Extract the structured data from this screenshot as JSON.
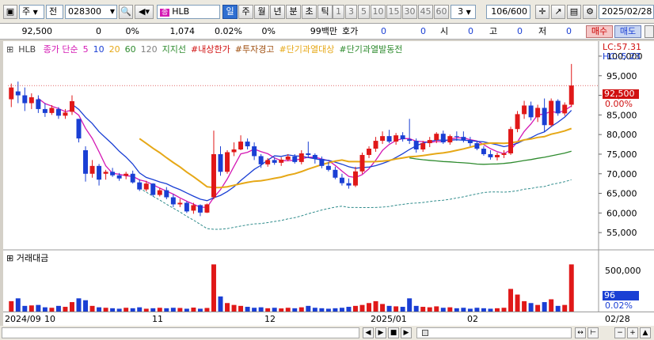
{
  "toolbar": {
    "period_select": "주",
    "scope_select": "전",
    "code": "028300",
    "name": "HLB",
    "period_tabs": [
      "일",
      "주",
      "월",
      "년",
      "분",
      "초",
      "틱"
    ],
    "active_period": "일",
    "intervals": [
      "1",
      "3",
      "5",
      "10",
      "15",
      "30",
      "45",
      "60"
    ],
    "interval_select": "3",
    "count": "106/600",
    "date": "2025/02/28"
  },
  "quote": {
    "price": "92,500",
    "change": "0",
    "rate": "0%",
    "volume": "1,074",
    "vol_rate": "0.02%",
    "vol_rate2": "0%",
    "amount": "99백만",
    "hoga_label": "호가",
    "hoga_val1": "0",
    "hoga_val2": "0",
    "open_label": "시",
    "open_val": "0",
    "high_label": "고",
    "high_val": "0",
    "low_label": "저",
    "low_val": "0",
    "buy_button": "매수",
    "sell_button": "매도"
  },
  "legend": {
    "name": "HLB",
    "ma_label": "종가 단순",
    "ma5": "5",
    "ma10": "10",
    "ma20": "20",
    "ma60": "60",
    "ma120": "120",
    "support": "지지선",
    "limit": "#내상한가",
    "warn": "#투자경고",
    "short1": "#단기과열대상",
    "short2": "#단기과열발동전",
    "colors": {
      "ma5": "#d418b4",
      "ma10": "#1a3fd4",
      "ma20": "#e6a817",
      "ma60": "#2e8b2e",
      "ma120": "#808080",
      "limit": "#d01010",
      "warn": "#a05010",
      "short1": "#e6a817",
      "short2": "#2e8b2e"
    }
  },
  "price_axis": {
    "ticks": [
      "100,000",
      "95,000",
      "90,000",
      "85,000",
      "80,000",
      "75,000",
      "70,000",
      "65,000",
      "60,000",
      "55,000"
    ],
    "lc": "LC:57.31",
    "hc": "HC:-5.23",
    "current": "92,500",
    "current_rate": "0.00%"
  },
  "volume_panel": {
    "title": "거래대금",
    "ticks": [
      "500,000"
    ],
    "current": "96",
    "current_rate": "0.02%"
  },
  "date_axis": {
    "labels": [
      "2024/09",
      "10",
      "11",
      "12",
      "2025/01",
      "02"
    ],
    "right_label": "02/28"
  },
  "chart_data": {
    "type": "candlestick",
    "y_range": [
      51000,
      101000
    ],
    "candles": [
      [
        89000,
        93000,
        87000,
        92000
      ],
      [
        91000,
        93500,
        88000,
        90000
      ],
      [
        90000,
        92000,
        86000,
        88000
      ],
      [
        88000,
        90500,
        86500,
        89500
      ],
      [
        89000,
        90000,
        85500,
        86500
      ],
      [
        86500,
        88000,
        84500,
        85500
      ],
      [
        85500,
        87500,
        85000,
        86800
      ],
      [
        86500,
        87000,
        84000,
        84800
      ],
      [
        84800,
        86500,
        84000,
        85600
      ],
      [
        85800,
        90000,
        85000,
        88500
      ],
      [
        84000,
        84000,
        78000,
        79000
      ],
      [
        76000,
        77000,
        68000,
        70000
      ],
      [
        70000,
        73500,
        69000,
        72000
      ],
      [
        72000,
        72500,
        67000,
        68500
      ],
      [
        70000,
        71000,
        68500,
        70500
      ],
      [
        70500,
        71500,
        69200,
        69600
      ],
      [
        69600,
        70200,
        68200,
        68800
      ],
      [
        69500,
        70500,
        68600,
        70000
      ],
      [
        70000,
        70800,
        67500,
        67800
      ],
      [
        67800,
        68600,
        65600,
        66000
      ],
      [
        66000,
        68200,
        65500,
        67500
      ],
      [
        67500,
        67600,
        64200,
        64600
      ],
      [
        64600,
        66400,
        64200,
        65800
      ],
      [
        65800,
        66600,
        63500,
        64000
      ],
      [
        64000,
        64800,
        61500,
        62200
      ],
      [
        62200,
        63600,
        61500,
        62600
      ],
      [
        62600,
        63000,
        60000,
        60400
      ],
      [
        60600,
        62600,
        59800,
        62000
      ],
      [
        62000,
        62200,
        59200,
        60100
      ],
      [
        60100,
        62400,
        60000,
        62200
      ],
      [
        64000,
        81000,
        63500,
        75000
      ],
      [
        75000,
        77000,
        69500,
        70500
      ],
      [
        70500,
        76000,
        70000,
        75500
      ],
      [
        75500,
        78000,
        74500,
        76200
      ],
      [
        76200,
        79800,
        76000,
        78200
      ],
      [
        78200,
        79000,
        76200,
        77000
      ],
      [
        77000,
        78000,
        73500,
        74500
      ],
      [
        74500,
        75000,
        71500,
        72400
      ],
      [
        72400,
        74000,
        71800,
        73500
      ],
      [
        73500,
        74200,
        72300,
        72800
      ],
      [
        72800,
        74200,
        72000,
        73600
      ],
      [
        73600,
        75000,
        73200,
        74400
      ],
      [
        74400,
        75000,
        72600,
        73000
      ],
      [
        73000,
        76000,
        72400,
        75200
      ],
      [
        75200,
        78200,
        74000,
        74800
      ],
      [
        74800,
        75200,
        72600,
        73800
      ],
      [
        73800,
        74400,
        71400,
        72000
      ],
      [
        72000,
        73000,
        70600,
        71000
      ],
      [
        71000,
        71800,
        68600,
        69000
      ],
      [
        69000,
        70000,
        67000,
        67600
      ],
      [
        67600,
        68800,
        66200,
        67000
      ],
      [
        67000,
        71800,
        66600,
        70600
      ],
      [
        70600,
        75400,
        70000,
        74800
      ],
      [
        74800,
        77000,
        74000,
        76400
      ],
      [
        76400,
        79400,
        75600,
        78400
      ],
      [
        78400,
        80800,
        77600,
        79600
      ],
      [
        79600,
        81200,
        77800,
        78200
      ],
      [
        78200,
        80400,
        77400,
        79800
      ],
      [
        79800,
        80600,
        78200,
        78800
      ],
      [
        78800,
        84000,
        77600,
        78400
      ],
      [
        78400,
        79000,
        75400,
        76200
      ],
      [
        76200,
        78400,
        75600,
        77800
      ],
      [
        77800,
        79400,
        76800,
        78600
      ],
      [
        78600,
        80600,
        77800,
        80200
      ],
      [
        80200,
        81000,
        77600,
        78000
      ],
      [
        78000,
        80000,
        77400,
        79600
      ],
      [
        79600,
        80800,
        78400,
        79400
      ],
      [
        79400,
        80800,
        78000,
        78600
      ],
      [
        78600,
        79400,
        77000,
        77800
      ],
      [
        77800,
        78200,
        76000,
        76400
      ],
      [
        76400,
        77000,
        74600,
        75000
      ],
      [
        75000,
        76000,
        73600,
        74200
      ],
      [
        74200,
        75400,
        73400,
        74800
      ],
      [
        74800,
        76000,
        74000,
        75200
      ],
      [
        75200,
        82000,
        74800,
        81400
      ],
      [
        81400,
        86000,
        80600,
        85200
      ],
      [
        85200,
        88600,
        84000,
        87400
      ],
      [
        87400,
        88400,
        83600,
        84400
      ],
      [
        84400,
        87600,
        83200,
        86800
      ],
      [
        86800,
        89200,
        80600,
        82400
      ],
      [
        82400,
        89200,
        82000,
        88600
      ],
      [
        88600,
        89000,
        84800,
        85400
      ],
      [
        85400,
        88200,
        84800,
        87600
      ],
      [
        87600,
        98000,
        87000,
        92500
      ]
    ],
    "volume_max": 520000,
    "volume": [
      110000,
      140000,
      60000,
      65000,
      70000,
      45000,
      40000,
      60000,
      50000,
      100000,
      140000,
      120000,
      60000,
      45000,
      40000,
      35000,
      30000,
      40000,
      35000,
      45000,
      30000,
      35000,
      40000,
      35000,
      40000,
      38000,
      30000,
      42000,
      30000,
      38000,
      500000,
      160000,
      90000,
      70000,
      60000,
      50000,
      40000,
      45000,
      35000,
      40000,
      33000,
      40000,
      35000,
      45000,
      60000,
      40000,
      35000,
      30000,
      35000,
      40000,
      50000,
      60000,
      70000,
      90000,
      110000,
      80000,
      60000,
      55000,
      50000,
      140000,
      60000,
      50000,
      45000,
      55000,
      40000,
      45000,
      35000,
      40000,
      30000,
      40000,
      35000,
      30000,
      35000,
      40000,
      240000,
      180000,
      110000,
      90000,
      70000,
      100000,
      130000,
      60000,
      70000,
      500000
    ]
  }
}
